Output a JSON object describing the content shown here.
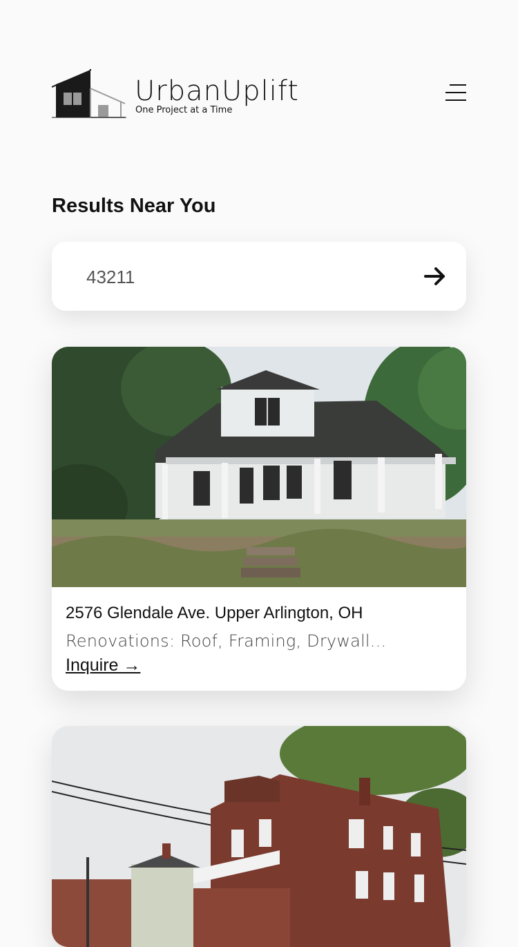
{
  "brand": {
    "name": "UrbanUplift",
    "tagline": "One Project at a Time"
  },
  "header": {
    "menu_icon": "hamburger-menu-icon"
  },
  "section": {
    "title": "Results Near You"
  },
  "search": {
    "value": "43211",
    "submit_icon": "arrow-right-icon"
  },
  "listings": [
    {
      "address": "2576 Glendale Ave. Upper Arlington, OH",
      "renovations": "Renovations: Roof, Framing, Drywall...",
      "cta": "Inquire →",
      "photo": "abandoned-white-farmhouse-photo"
    },
    {
      "photo": "brick-multifamily-house-photo"
    }
  ]
}
